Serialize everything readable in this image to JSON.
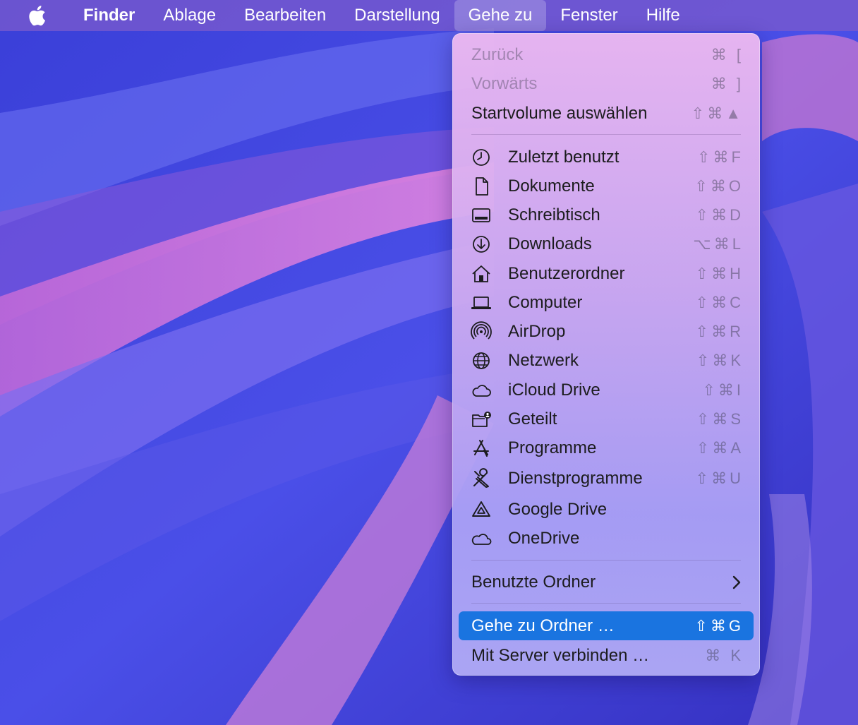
{
  "menubar": {
    "items": [
      {
        "label": "Finder"
      },
      {
        "label": "Ablage"
      },
      {
        "label": "Bearbeiten"
      },
      {
        "label": "Darstellung"
      },
      {
        "label": "Gehe zu"
      },
      {
        "label": "Fenster"
      },
      {
        "label": "Hilfe"
      }
    ]
  },
  "menu": {
    "top": [
      {
        "label": "Zurück",
        "shortcut": "⌘ ["
      },
      {
        "label": "Vorwärts",
        "shortcut": "⌘ ]"
      },
      {
        "label": "Startvolume auswählen",
        "shortcut": "⇧⌘▲"
      }
    ],
    "places": [
      {
        "label": "Zuletzt benutzt",
        "shortcut": "⇧⌘F",
        "icon": "clock-icon"
      },
      {
        "label": "Dokumente",
        "shortcut": "⇧⌘O",
        "icon": "document-icon"
      },
      {
        "label": "Schreibtisch",
        "shortcut": "⇧⌘D",
        "icon": "desktop-icon"
      },
      {
        "label": "Downloads",
        "shortcut": "⌥⌘L",
        "icon": "download-icon"
      },
      {
        "label": "Benutzerordner",
        "shortcut": "⇧⌘H",
        "icon": "home-icon"
      },
      {
        "label": "Computer",
        "shortcut": "⇧⌘C",
        "icon": "laptop-icon"
      },
      {
        "label": "AirDrop",
        "shortcut": "⇧⌘R",
        "icon": "airdrop-icon"
      },
      {
        "label": "Netzwerk",
        "shortcut": "⇧⌘K",
        "icon": "globe-icon"
      },
      {
        "label": "iCloud Drive",
        "shortcut": "⇧⌘I",
        "icon": "cloud-icon"
      },
      {
        "label": "Geteilt",
        "shortcut": "⇧⌘S",
        "icon": "shared-folder-icon"
      },
      {
        "label": "Programme",
        "shortcut": "⇧⌘A",
        "icon": "app-store-icon"
      },
      {
        "label": "Dienstprogramme",
        "shortcut": "⇧⌘U",
        "icon": "tools-icon"
      },
      {
        "label": "Google Drive",
        "shortcut": "",
        "icon": "google-drive-icon"
      },
      {
        "label": "OneDrive",
        "shortcut": "",
        "icon": "onedrive-icon"
      }
    ],
    "recent": {
      "label": "Benutzte Ordner"
    },
    "bottom": [
      {
        "label": "Gehe zu Ordner …",
        "shortcut": "⇧⌘G"
      },
      {
        "label": "Mit Server verbinden …",
        "shortcut": "⌘ K"
      }
    ]
  },
  "colors": {
    "highlight": "#1a74e0",
    "menubar": "#785acd"
  }
}
